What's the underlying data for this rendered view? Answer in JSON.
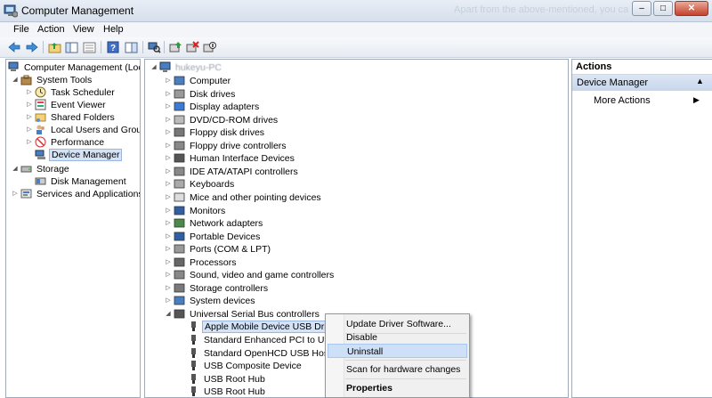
{
  "window": {
    "title": "Computer Management",
    "ghost_text": "Apart from the above-mentioned, you ca",
    "buttons": {
      "minimize": "–",
      "maximize": "□",
      "close": "✕"
    }
  },
  "menu": {
    "file": "File",
    "action": "Action",
    "view": "View",
    "help": "Help"
  },
  "left_tree": {
    "root": "Computer Management (Local",
    "system_tools": "System Tools",
    "task_scheduler": "Task Scheduler",
    "event_viewer": "Event Viewer",
    "shared_folders": "Shared Folders",
    "local_users": "Local Users and Groups",
    "performance": "Performance",
    "device_manager": "Device Manager",
    "storage": "Storage",
    "disk_management": "Disk Management",
    "services": "Services and Applications"
  },
  "device_tree": {
    "root": "hukeyu-PC",
    "categories": [
      "Computer",
      "Disk drives",
      "Display adapters",
      "DVD/CD-ROM drives",
      "Floppy disk drives",
      "Floppy drive controllers",
      "Human Interface Devices",
      "IDE ATA/ATAPI controllers",
      "Keyboards",
      "Mice and other pointing devices",
      "Monitors",
      "Network adapters",
      "Portable Devices",
      "Ports (COM & LPT)",
      "Processors",
      "Sound, video and game controllers",
      "Storage controllers",
      "System devices",
      "Universal Serial Bus controllers"
    ],
    "usb_children": [
      "Apple Mobile Device USB Driver",
      "Standard Enhanced PCI to USB H",
      "Standard OpenHCD USB Host Co",
      "USB Composite Device",
      "USB Root Hub",
      "USB Root Hub"
    ]
  },
  "actions_panel": {
    "header": "Actions",
    "section": "Device Manager",
    "more_actions": "More Actions"
  },
  "context_menu": {
    "update": "Update Driver Software...",
    "disable": "Disable",
    "uninstall": "Uninstall",
    "scan": "Scan for hardware changes",
    "properties": "Properties"
  },
  "colors": {
    "selection": "#d5e3f7",
    "hover": "#cde0f7",
    "pane_header": "#c7d6ec"
  }
}
